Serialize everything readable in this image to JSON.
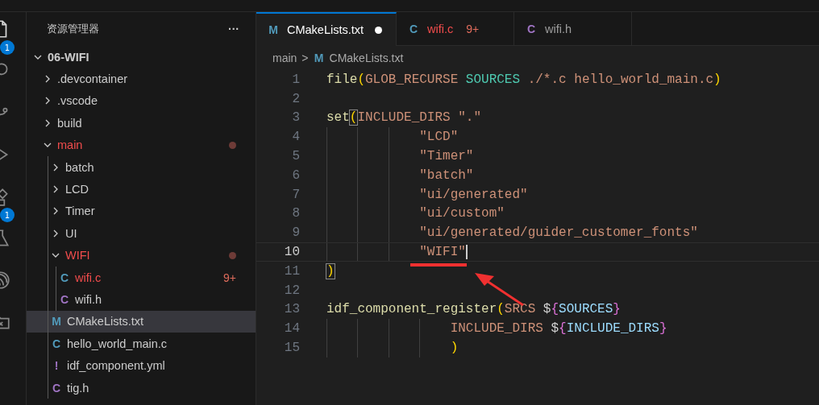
{
  "activity_bar": [
    {
      "kind": "files",
      "badge": "1",
      "selected": true
    },
    {
      "kind": "search",
      "selected": false
    },
    {
      "kind": "source-control",
      "selected": false
    },
    {
      "kind": "run",
      "selected": false
    },
    {
      "kind": "extensions",
      "badge": "1",
      "selected": false
    },
    {
      "kind": "testing",
      "selected": false
    },
    {
      "kind": "espressif",
      "selected": false
    },
    {
      "kind": "remote",
      "selected": false
    }
  ],
  "sidebar": {
    "title": "资源管理器",
    "more": "···",
    "root": {
      "label": "06-WIFI",
      "expanded": true,
      "children": [
        {
          "kind": "folder",
          "label": ".devcontainer",
          "expanded": false,
          "modified": false,
          "selected": false
        },
        {
          "kind": "folder",
          "label": ".vscode",
          "expanded": false,
          "modified": false,
          "selected": false
        },
        {
          "kind": "folder",
          "label": "build",
          "expanded": false,
          "modified": false,
          "selected": false
        },
        {
          "kind": "folder",
          "label": "main",
          "expanded": true,
          "modified": true,
          "selected": false,
          "children": [
            {
              "kind": "folder",
              "label": "batch",
              "expanded": false,
              "modified": false,
              "selected": false
            },
            {
              "kind": "folder",
              "label": "LCD",
              "expanded": false,
              "modified": false,
              "selected": false
            },
            {
              "kind": "folder",
              "label": "Timer",
              "expanded": false,
              "modified": false,
              "selected": false
            },
            {
              "kind": "folder",
              "label": "UI",
              "expanded": false,
              "modified": false,
              "selected": false
            },
            {
              "kind": "folder",
              "label": "WIFI",
              "expanded": true,
              "modified": true,
              "selected": false,
              "children": [
                {
                  "kind": "file",
                  "icon": "C",
                  "color": "#519aba",
                  "label": "wifi.c",
                  "modified": true,
                  "problems": "9+",
                  "selected": false
                },
                {
                  "kind": "file",
                  "icon": "C",
                  "color": "#a074c4",
                  "label": "wifi.h",
                  "modified": false,
                  "selected": false
                }
              ]
            },
            {
              "kind": "file",
              "icon": "M",
              "color": "#519aba",
              "label": "CMakeLists.txt",
              "modified": false,
              "selected": true
            },
            {
              "kind": "file",
              "icon": "C",
              "color": "#519aba",
              "label": "hello_world_main.c",
              "modified": false,
              "selected": false
            },
            {
              "kind": "file",
              "icon": "!",
              "color": "#a074c4",
              "label": "idf_component.yml",
              "modified": false,
              "selected": false
            },
            {
              "kind": "file",
              "icon": "C",
              "color": "#a074c4",
              "label": "tig.h",
              "modified": false,
              "selected": false
            }
          ]
        }
      ]
    }
  },
  "tabs": [
    {
      "icon": "M",
      "color": "#519aba",
      "label": "CMakeLists.txt",
      "selected": true,
      "dirty": true,
      "modified": false
    },
    {
      "icon": "C",
      "color": "#519aba",
      "label": "wifi.c",
      "problems": "9+",
      "selected": false,
      "dirty": false,
      "modified": true
    },
    {
      "icon": "C",
      "color": "#a074c4",
      "label": "wifi.h",
      "selected": false,
      "dirty": false,
      "modified": false
    }
  ],
  "breadcrumb": {
    "folder": "main",
    "separator": ">",
    "file_icon": "M",
    "file": "CMakeLists.txt"
  },
  "editor": {
    "lines": [
      {
        "number": "1",
        "current": false,
        "tokens": [
          {
            "kind": "fn",
            "text": "file"
          },
          {
            "kind": "paren",
            "text": "("
          },
          {
            "kind": "arg",
            "text": "GLOB_RECURSE "
          },
          {
            "kind": "var",
            "text": "SOURCES"
          },
          {
            "kind": "arg",
            "text": " ./*.c hello_world_main.c"
          },
          {
            "kind": "paren",
            "text": ")"
          }
        ]
      },
      {
        "number": "2",
        "current": false
      },
      {
        "number": "3",
        "current": false,
        "tokens": [
          {
            "kind": "fn",
            "text": "set"
          },
          {
            "kind": "paren-match",
            "text": "("
          },
          {
            "kind": "arg",
            "text": "INCLUDE_DIRS \".\""
          }
        ]
      },
      {
        "number": "4",
        "current": false,
        "tokens": [
          {
            "kind": "str",
            "text": "            \"LCD\""
          }
        ]
      },
      {
        "number": "5",
        "current": false,
        "tokens": [
          {
            "kind": "str",
            "text": "            \"Timer\""
          }
        ]
      },
      {
        "number": "6",
        "current": false,
        "tokens": [
          {
            "kind": "str",
            "text": "            \"batch\""
          }
        ]
      },
      {
        "number": "7",
        "current": false,
        "tokens": [
          {
            "kind": "str",
            "text": "            \"ui/generated\""
          }
        ]
      },
      {
        "number": "8",
        "current": false,
        "tokens": [
          {
            "kind": "str",
            "text": "            \"ui/custom\""
          }
        ]
      },
      {
        "number": "9",
        "current": false,
        "tokens": [
          {
            "kind": "str",
            "text": "            \"ui/generated/guider_customer_fonts\""
          }
        ]
      },
      {
        "number": "10",
        "current": true,
        "tokens": [
          {
            "kind": "str",
            "text": "            \"WIFI\""
          }
        ]
      },
      {
        "number": "11",
        "current": false,
        "tokens": [
          {
            "kind": "paren-match",
            "text": ")"
          }
        ]
      },
      {
        "number": "12",
        "current": false
      },
      {
        "number": "13",
        "current": false,
        "tokens": [
          {
            "kind": "fn",
            "text": "idf_component_register"
          },
          {
            "kind": "paren",
            "text": "("
          },
          {
            "kind": "arg",
            "text": "SRCS "
          },
          {
            "kind": "plain",
            "text": "$"
          },
          {
            "kind": "brace",
            "text": "{"
          },
          {
            "kind": "ref",
            "text": "SOURCES"
          },
          {
            "kind": "brace",
            "text": "}"
          }
        ]
      },
      {
        "number": "14",
        "current": false,
        "tokens": [
          {
            "kind": "arg",
            "text": "                INCLUDE_DIRS "
          },
          {
            "kind": "plain",
            "text": "$"
          },
          {
            "kind": "brace",
            "text": "{"
          },
          {
            "kind": "ref",
            "text": "INCLUDE_DIRS"
          },
          {
            "kind": "brace",
            "text": "}"
          }
        ]
      },
      {
        "number": "15",
        "current": false,
        "tokens": [
          {
            "kind": "paren",
            "text": "                )"
          }
        ]
      }
    ]
  }
}
